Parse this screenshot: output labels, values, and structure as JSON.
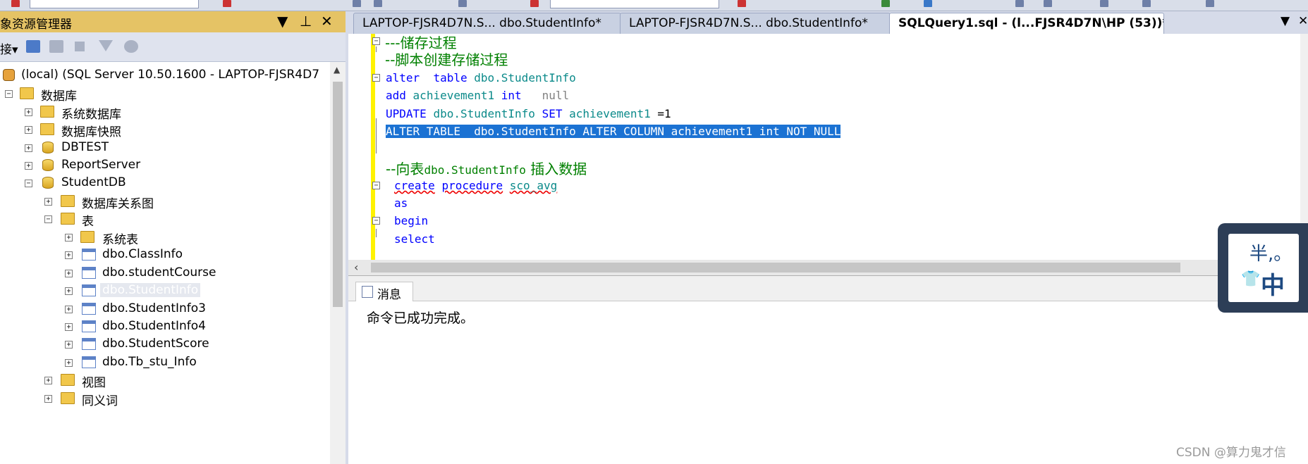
{
  "object_explorer": {
    "title": "象资源管理器",
    "connect_label": "接▾",
    "tree": [
      {
        "label": "(local) (SQL Server 10.50.1600 - LAPTOP-FJSR4D7",
        "icon": "server-icon",
        "expander": "",
        "name": "tree-node-server"
      },
      {
        "label": "数据库",
        "icon": "folder-icon",
        "expander": "⊟",
        "name": "tree-node-databases"
      },
      {
        "label": "系统数据库",
        "icon": "folder-icon",
        "expander": "+",
        "name": "tree-node-system-databases"
      },
      {
        "label": "数据库快照",
        "icon": "folder-icon",
        "expander": "+",
        "name": "tree-node-database-snapshots"
      },
      {
        "label": "DBTEST",
        "icon": "database-icon",
        "expander": "+",
        "name": "tree-node-dbtest"
      },
      {
        "label": "ReportServer",
        "icon": "database-icon",
        "expander": "+",
        "name": "tree-node-reportserver"
      },
      {
        "label": "StudentDB",
        "icon": "database-icon",
        "expander": "−",
        "name": "tree-node-studentdb"
      },
      {
        "label": "数据库关系图",
        "icon": "folder-icon",
        "expander": "+",
        "name": "tree-node-diagrams"
      },
      {
        "label": "表",
        "icon": "folder-icon",
        "expander": "−",
        "name": "tree-node-tables"
      },
      {
        "label": "系统表",
        "icon": "folder-icon",
        "expander": "+",
        "name": "tree-node-system-tables"
      },
      {
        "label": "dbo.ClassInfo",
        "icon": "table-icon",
        "expander": "+",
        "name": "tree-node-classinfo"
      },
      {
        "label": "dbo.studentCourse",
        "icon": "table-icon",
        "expander": "+",
        "name": "tree-node-studentcourse"
      },
      {
        "label": "dbo.StudentInfo",
        "icon": "table-icon",
        "expander": "+",
        "name": "tree-node-studentinfo",
        "selected": true
      },
      {
        "label": "dbo.StudentInfo3",
        "icon": "table-icon",
        "expander": "+",
        "name": "tree-node-studentinfo3"
      },
      {
        "label": "dbo.StudentInfo4",
        "icon": "table-icon",
        "expander": "+",
        "name": "tree-node-studentinfo4"
      },
      {
        "label": "dbo.StudentScore",
        "icon": "table-icon",
        "expander": "+",
        "name": "tree-node-studentscore"
      },
      {
        "label": "dbo.Tb_stu_Info",
        "icon": "table-icon",
        "expander": "+",
        "name": "tree-node-tb-stu-info"
      },
      {
        "label": "视图",
        "icon": "folder-icon",
        "expander": "+",
        "name": "tree-node-views"
      },
      {
        "label": "同义词",
        "icon": "folder-icon",
        "expander": "+",
        "name": "tree-node-synonyms"
      }
    ]
  },
  "tabs": [
    {
      "label": "LAPTOP-FJSR4D7N.S... dbo.StudentInfo*",
      "active": false
    },
    {
      "label": "LAPTOP-FJSR4D7N.S... dbo.StudentInfo*",
      "active": false
    },
    {
      "label": "SQLQuery1.sql - (l...FJSR4D7N\\HP (53))*",
      "active": true
    }
  ],
  "editor": {
    "line1": "---储存过程",
    "line2": "--脚本创建存储过程",
    "line3_kw1": "alter",
    "line3_kw2": "table",
    "line3_obj": "dbo.StudentInfo",
    "line4_kw1": "add",
    "line4_obj": "achievement1",
    "line4_kw2": "int",
    "line4_null": "null",
    "line5_kw1": "UPDATE",
    "line5_obj": "dbo.StudentInfo",
    "line5_kw2": "SET",
    "line5_obj2": "achievement1",
    "line5_val": "=1",
    "line6": "ALTER TABLE  dbo.StudentInfo ALTER COLUMN achievement1 int NOT NULL",
    "line8_prefix": "--向表",
    "line8_obj": "dbo.StudentInfo",
    "line8_suffix": " 插入数据",
    "line9_kw1": "create",
    "line9_kw2": "procedure",
    "line9_name": "sco_avg",
    "line10": "as",
    "line11": "begin",
    "line12": "select"
  },
  "messages": {
    "tab_label": "消息",
    "text": "命令已成功完成。"
  },
  "ime": {
    "half_label": "半,。",
    "mode_label": "中"
  },
  "watermark": "CSDN @算力鬼才信",
  "colors": {
    "explorer_header": "#e5c365",
    "selection": "#1b72d3",
    "keyword": "#0000ff",
    "comment": "#008000",
    "object": "#0b8a8a"
  }
}
